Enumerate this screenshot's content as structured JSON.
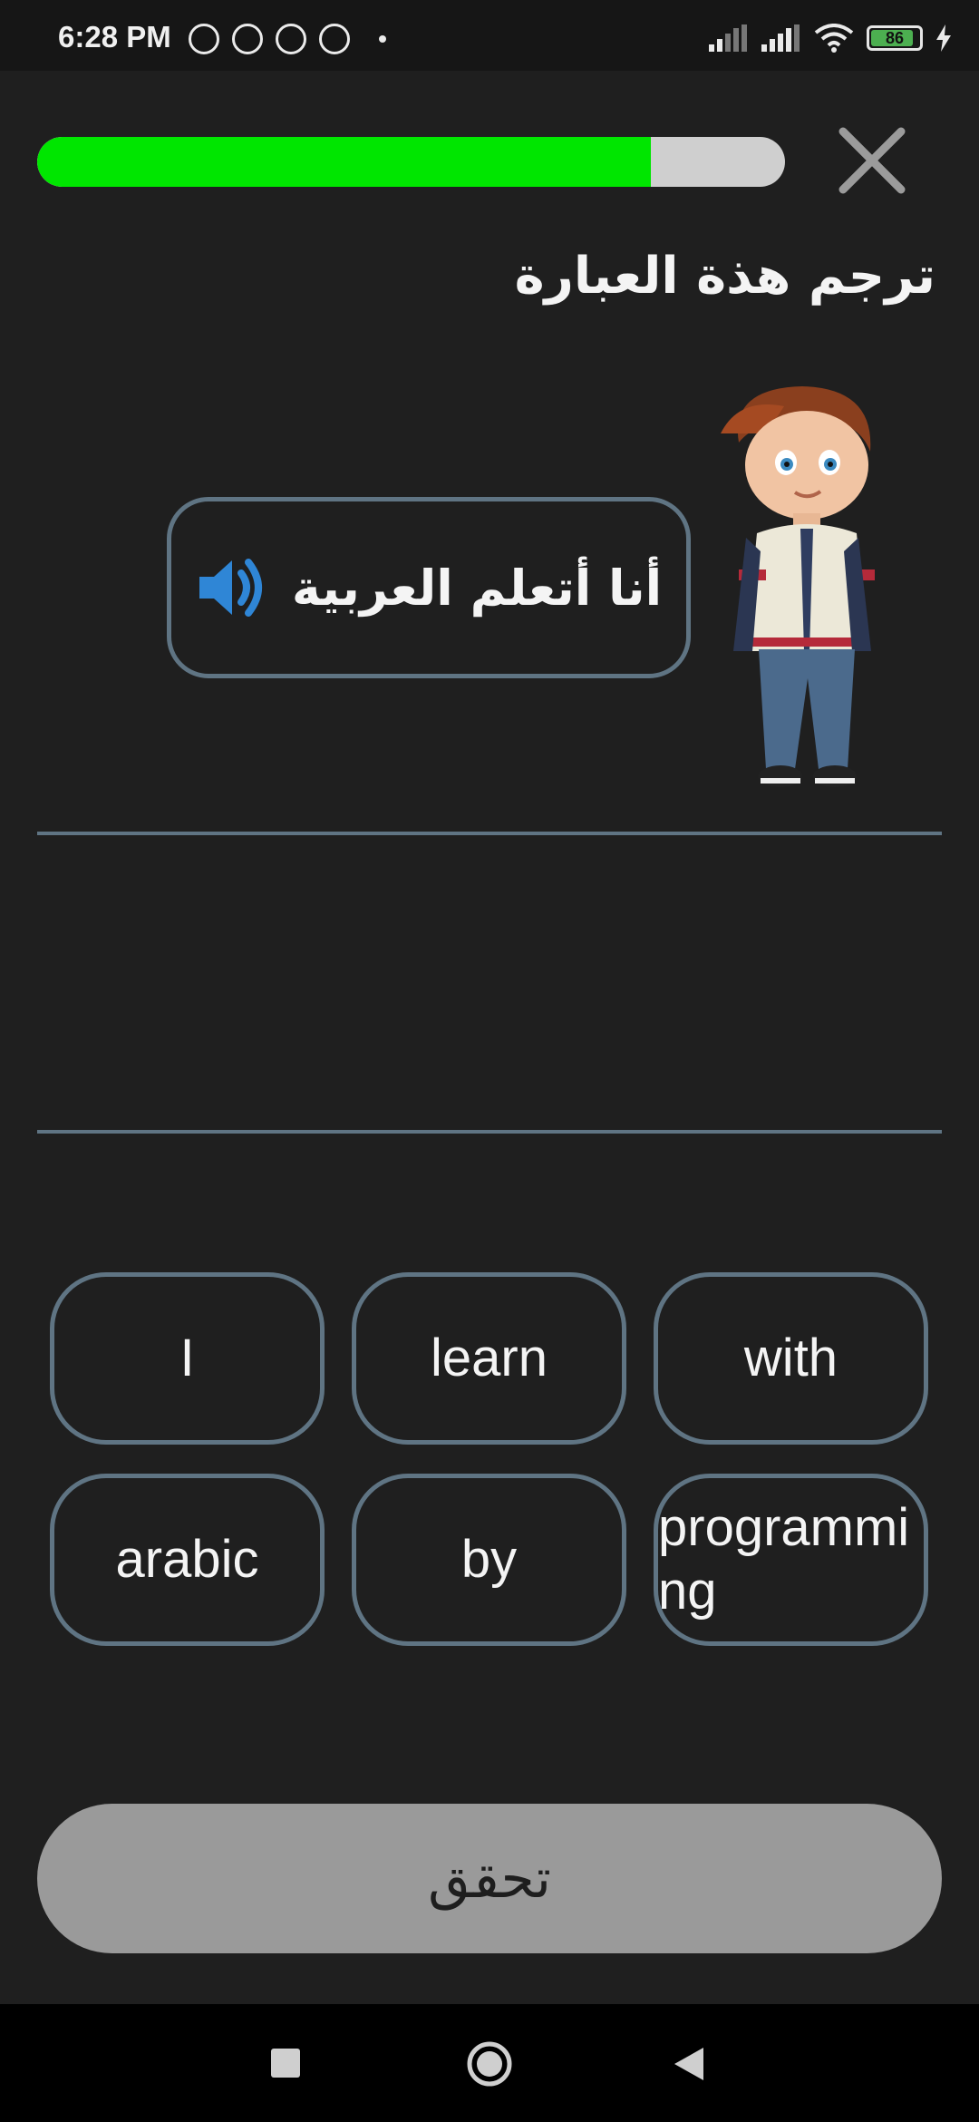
{
  "status_bar": {
    "time": "6:28 PM",
    "battery": "86",
    "icons": [
      "alarm-icon",
      "whatsapp-icon",
      "notification-icon",
      "notification-icon",
      "dot-icon",
      "signal-icon",
      "signal-icon",
      "wifi-icon",
      "battery-icon",
      "charging-icon"
    ]
  },
  "lesson": {
    "progress": 0.82,
    "close_icon": "close-icon",
    "prompt": "ترجم هذة العبارة",
    "phrase": "أنا أتعلم العربية",
    "speaker_icon": "speaker-icon"
  },
  "word_bank": [
    "I",
    "learn",
    "with",
    "arabic",
    "by",
    "programming"
  ],
  "actions": {
    "check_label": "تحقق"
  },
  "nav": {
    "icons": [
      "recents-icon",
      "home-icon",
      "back-icon"
    ]
  },
  "colors": {
    "accent": "#00e600",
    "border": "#5f7483",
    "background": "#1f1f1f",
    "speaker": "#2f86d6",
    "button_disabled": "#9a9a9a"
  }
}
